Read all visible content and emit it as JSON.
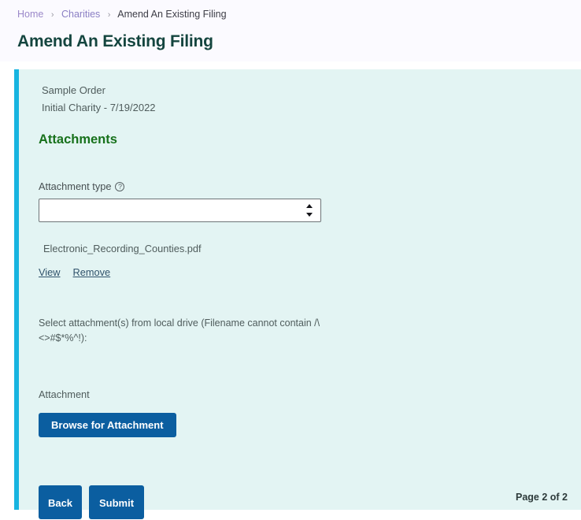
{
  "breadcrumb": {
    "items": [
      {
        "label": "Home",
        "type": "link"
      },
      {
        "label": "Charities",
        "type": "link"
      },
      {
        "label": "Amend An Existing Filing",
        "type": "current"
      }
    ],
    "separator": "›"
  },
  "page": {
    "title": "Amend An Existing Filing"
  },
  "panel": {
    "order_name": "Sample Order",
    "order_detail": "Initial Charity - 7/19/2022",
    "section_heading": "Attachments",
    "accent_color": "#17b4e0",
    "background_color": "#e3f4f3",
    "heading_color": "#17711b"
  },
  "attachment_type": {
    "label": "Attachment type",
    "help_icon": "help-circle-icon",
    "help_glyph": "?",
    "selected_value": "",
    "options": [
      ""
    ]
  },
  "existing_file": {
    "name": "Electronic_Recording_Counties.pdf",
    "view_label": "View",
    "remove_label": "Remove"
  },
  "upload": {
    "instructions": "Select attachment(s) from local drive (Filename cannot contain /\\ <>#$*%^!):",
    "attachment_label": "Attachment",
    "browse_label": "Browse for Attachment"
  },
  "actions": {
    "back_label": "Back",
    "submit_label": "Submit",
    "button_color": "#0b5ea0"
  },
  "footer": {
    "page_indicator": "Page 2 of 2"
  }
}
